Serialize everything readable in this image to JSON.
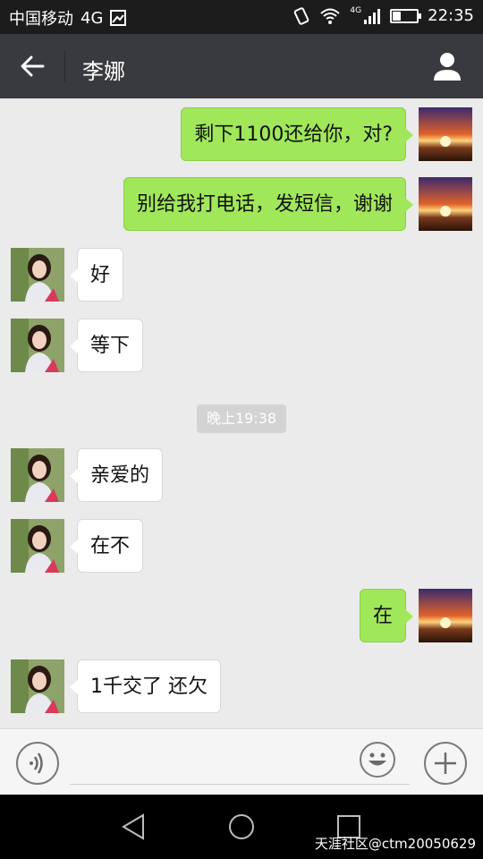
{
  "status_bar": {
    "carrier": "中国移动",
    "network": "4G",
    "signal_label": "4G",
    "time": "22:35"
  },
  "header": {
    "title": "李娜"
  },
  "messages": [
    {
      "side": "sent",
      "text": "剩下1100还给你，对?"
    },
    {
      "side": "sent",
      "text": "别给我打电话，发短信，谢谢"
    },
    {
      "side": "recv",
      "text": "好"
    },
    {
      "side": "recv",
      "text": "等下"
    },
    {
      "side": "recv",
      "text": "亲爱的"
    },
    {
      "side": "recv",
      "text": "在不"
    },
    {
      "side": "sent",
      "text": "在"
    },
    {
      "side": "recv",
      "text": "1千交了 还欠"
    }
  ],
  "timestamp": "晚上19:38",
  "input": {
    "value": "",
    "placeholder": ""
  },
  "watermark": "天涯社区@ctm20050629",
  "icons": {
    "back": "back-arrow-icon",
    "profile": "person-icon",
    "voice": "voice-icon",
    "emoji": "emoji-icon",
    "plus": "plus-icon",
    "nav_back": "nav-back-icon",
    "nav_home": "nav-home-icon",
    "nav_recent": "nav-recent-icon"
  },
  "colors": {
    "title_bar": "#393a3f",
    "sent_bubble": "#a0e75a",
    "received_bubble": "#ffffff",
    "chat_background": "#ebebeb"
  }
}
